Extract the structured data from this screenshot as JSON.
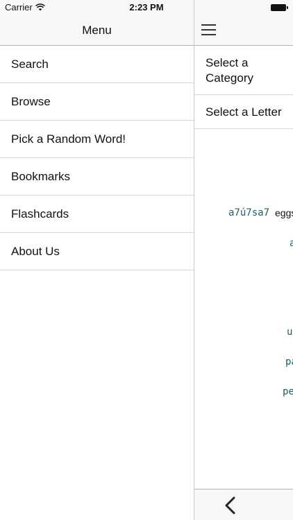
{
  "status_bar": {
    "carrier": "Carrier",
    "time": "2:23 PM",
    "icons": [
      "wifi-icon",
      "battery-icon"
    ]
  },
  "menu": {
    "title": "Menu",
    "items": [
      {
        "label": "Search"
      },
      {
        "label": "Browse"
      },
      {
        "label": "Pick a Random Word!"
      },
      {
        "label": "Bookmarks"
      },
      {
        "label": "Flashcards"
      },
      {
        "label": "About Us"
      }
    ]
  },
  "content": {
    "menu_icon": "hamburger-icon",
    "filters": {
      "category": "Select a Category",
      "letter": "Select a Letter"
    },
    "words": [
      {
        "translit": "a7ú7sa7",
        "english": "eggs"
      },
      {
        "translit": "a",
        "english": ""
      },
      {
        "translit": "u",
        "english": ""
      },
      {
        "translit": "pa",
        "english": ""
      },
      {
        "translit": "pe",
        "english": ""
      }
    ],
    "back_icon": "chevron-left-icon"
  },
  "colors": {
    "bar_background": "#f7f7f7",
    "translit_text": "#1d5e63",
    "separator": "#d6d6d6"
  }
}
